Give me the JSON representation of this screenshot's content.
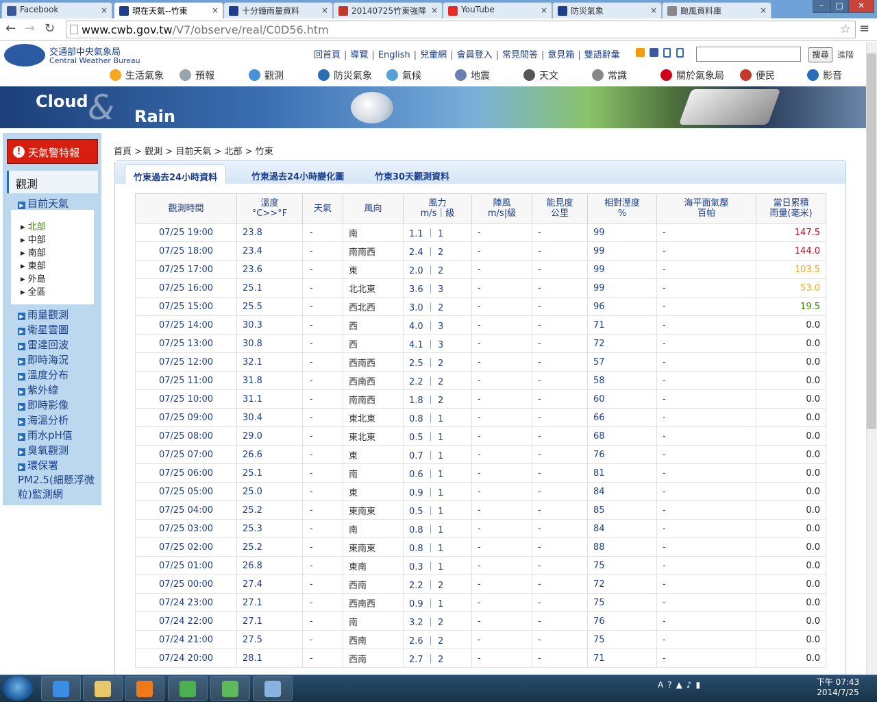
{
  "browser": {
    "tabs": [
      {
        "label": "Facebook",
        "icon": "facebook-icon",
        "color": "#3b5998",
        "active": false
      },
      {
        "label": "現在天氣--竹東",
        "icon": "cwb-eye-icon",
        "color": "#1d3f8a",
        "active": true
      },
      {
        "label": "十分鐘雨量資料",
        "icon": "cwb-eye-icon",
        "color": "#1d3f8a",
        "active": false
      },
      {
        "label": "20140725竹東強降",
        "icon": "swirl-icon",
        "color": "#c0392b",
        "active": false
      },
      {
        "label": "YouTube",
        "icon": "youtube-icon",
        "color": "#e52d27",
        "active": false
      },
      {
        "label": "防災氣象",
        "icon": "cwb-eye-icon",
        "color": "#1d3f8a",
        "active": false
      },
      {
        "label": "颱風資料庫",
        "icon": "document-icon",
        "color": "#888888",
        "active": false
      }
    ],
    "url_domain": "www.cwb.gov.tw",
    "url_path": "/V7/observe/real/C0D56.htm"
  },
  "site": {
    "logo_zh": "交通部中央氣象局",
    "logo_en": "Central Weather Bureau",
    "top_links": [
      "回首頁",
      "導覽",
      "English",
      "兒童網",
      "會員登入",
      "常見問答",
      "意見箱",
      "雙語辭彙"
    ],
    "search_value": "",
    "search_button": "搜尋",
    "advanced": "進階",
    "nav": [
      {
        "label": "生活氣象",
        "icon": "sun-icon",
        "color": "#f5a623"
      },
      {
        "label": "預報",
        "icon": "cloud-icon",
        "color": "#9aa4ad"
      },
      {
        "label": "觀測",
        "icon": "observe-icon",
        "color": "#4a90d9"
      },
      {
        "label": "防災氣象",
        "icon": "typhoon-icon",
        "color": "#2b6cb5"
      },
      {
        "label": "氣候",
        "icon": "climate-icon",
        "color": "#5aa0d8"
      },
      {
        "label": "地震",
        "icon": "earthquake-icon",
        "color": "#6a7fb0"
      },
      {
        "label": "天文",
        "icon": "telescope-icon",
        "color": "#555555"
      },
      {
        "label": "常識",
        "icon": "magnifier-icon",
        "color": "#888888"
      },
      {
        "label": "關於氣象局",
        "icon": "person-icon",
        "color": "#d0021b"
      },
      {
        "label": "便民",
        "icon": "users-icon",
        "color": "#c0392b"
      },
      {
        "label": "影音",
        "icon": "play-icon",
        "color": "#2b6cb5"
      }
    ],
    "banner_word1": "Cloud",
    "banner_word2": "&",
    "banner_word3": "Rain"
  },
  "sidebar": {
    "alert": "天氣警特報",
    "section": "觀測",
    "current": "目前天氣",
    "regions": [
      "北部",
      "中部",
      "南部",
      "東部",
      "外島",
      "全區"
    ],
    "selected_region": "北部",
    "links": [
      "雨量觀測",
      "衛星雲圖",
      "雷達回波",
      "即時海況",
      "溫度分布",
      "紫外線",
      "即時影像",
      "海溫分析",
      "雨水pH值",
      "臭氧觀測",
      "環保署"
    ],
    "pm_link": "PM2.5(細懸浮微粒)監測網"
  },
  "content": {
    "breadcrumb": "首頁 > 觀測 > 目前天氣 > 北部 > 竹東",
    "tabs": [
      "竹東過去24小時資料",
      "竹東過去24小時變化圖",
      "竹東30天觀測資料"
    ],
    "headers": [
      [
        "觀測時間",
        ""
      ],
      [
        "溫度",
        "°C>>°F"
      ],
      [
        "天氣",
        ""
      ],
      [
        "風向",
        ""
      ],
      [
        "風力",
        "m/s｜級"
      ],
      [
        "陣風",
        "m/s|級"
      ],
      [
        "能見度",
        "公里"
      ],
      [
        "相對溼度",
        "%"
      ],
      [
        "海平面氣壓",
        "百帕"
      ],
      [
        "當日累積",
        "雨量(毫米)"
      ]
    ],
    "rows": [
      [
        "07/25 19:00",
        "23.8",
        "-",
        "南",
        "1.1 ｜ 1",
        "-",
        "-",
        "99",
        "-",
        "147.5"
      ],
      [
        "07/25 18:00",
        "23.4",
        "-",
        "南南西",
        "2.4 ｜ 2",
        "-",
        "-",
        "99",
        "-",
        "144.0"
      ],
      [
        "07/25 17:00",
        "23.6",
        "-",
        "東",
        "2.0 ｜ 2",
        "-",
        "-",
        "99",
        "-",
        "103.5"
      ],
      [
        "07/25 16:00",
        "25.1",
        "-",
        "北北東",
        "3.6 ｜ 3",
        "-",
        "-",
        "99",
        "-",
        "53.0"
      ],
      [
        "07/25 15:00",
        "25.5",
        "-",
        "西北西",
        "3.0 ｜ 2",
        "-",
        "-",
        "96",
        "-",
        "19.5"
      ],
      [
        "07/25 14:00",
        "30.3",
        "-",
        "西",
        "4.0 ｜ 3",
        "-",
        "-",
        "71",
        "-",
        "0.0"
      ],
      [
        "07/25 13:00",
        "30.8",
        "-",
        "西",
        "4.1 ｜ 3",
        "-",
        "-",
        "72",
        "-",
        "0.0"
      ],
      [
        "07/25 12:00",
        "32.1",
        "-",
        "西南西",
        "2.5 ｜ 2",
        "-",
        "-",
        "57",
        "-",
        "0.0"
      ],
      [
        "07/25 11:00",
        "31.8",
        "-",
        "西南西",
        "2.2 ｜ 2",
        "-",
        "-",
        "58",
        "-",
        "0.0"
      ],
      [
        "07/25 10:00",
        "31.1",
        "-",
        "南南西",
        "1.8 ｜ 2",
        "-",
        "-",
        "60",
        "-",
        "0.0"
      ],
      [
        "07/25 09:00",
        "30.4",
        "-",
        "東北東",
        "0.8 ｜ 1",
        "-",
        "-",
        "66",
        "-",
        "0.0"
      ],
      [
        "07/25 08:00",
        "29.0",
        "-",
        "東北東",
        "0.5 ｜ 1",
        "-",
        "-",
        "68",
        "-",
        "0.0"
      ],
      [
        "07/25 07:00",
        "26.6",
        "-",
        "東",
        "0.7 ｜ 1",
        "-",
        "-",
        "76",
        "-",
        "0.0"
      ],
      [
        "07/25 06:00",
        "25.1",
        "-",
        "南",
        "0.6 ｜ 1",
        "-",
        "-",
        "81",
        "-",
        "0.0"
      ],
      [
        "07/25 05:00",
        "25.0",
        "-",
        "東",
        "0.9 ｜ 1",
        "-",
        "-",
        "84",
        "-",
        "0.0"
      ],
      [
        "07/25 04:00",
        "25.2",
        "-",
        "東南東",
        "0.5 ｜ 1",
        "-",
        "-",
        "85",
        "-",
        "0.0"
      ],
      [
        "07/25 03:00",
        "25.3",
        "-",
        "南",
        "0.8 ｜ 1",
        "-",
        "-",
        "84",
        "-",
        "0.0"
      ],
      [
        "07/25 02:00",
        "25.2",
        "-",
        "東南東",
        "0.8 ｜ 1",
        "-",
        "-",
        "88",
        "-",
        "0.0"
      ],
      [
        "07/25 01:00",
        "26.8",
        "-",
        "東南",
        "0.3 ｜ 1",
        "-",
        "-",
        "75",
        "-",
        "0.0"
      ],
      [
        "07/25 00:00",
        "27.4",
        "-",
        "西南",
        "2.2 ｜ 2",
        "-",
        "-",
        "72",
        "-",
        "0.0"
      ],
      [
        "07/24 23:00",
        "27.1",
        "-",
        "西南西",
        "0.9 ｜ 1",
        "-",
        "-",
        "75",
        "-",
        "0.0"
      ],
      [
        "07/24 22:00",
        "27.1",
        "-",
        "南",
        "3.2 ｜ 2",
        "-",
        "-",
        "76",
        "-",
        "0.0"
      ],
      [
        "07/24 21:00",
        "27.5",
        "-",
        "西南",
        "2.6 ｜ 2",
        "-",
        "-",
        "75",
        "-",
        "0.0"
      ],
      [
        "07/24 20:00",
        "28.1",
        "-",
        "西南",
        "2.7 ｜ 2",
        "-",
        "-",
        "71",
        "-",
        "0.0"
      ]
    ],
    "rain_colors": {
      "147.5": "#d0021b",
      "144.0": "#d0021b",
      "103.5": "#f5a623",
      "53.0": "#f5a623",
      "19.5": "#3b8a00"
    }
  },
  "taskbar": {
    "apps": [
      {
        "name": "ie-icon",
        "color": "#3a8ee6"
      },
      {
        "name": "explorer-icon",
        "color": "#e8c86a"
      },
      {
        "name": "media-player-icon",
        "color": "#f07a1a"
      },
      {
        "name": "chrome-icon",
        "color": "#4caf50"
      },
      {
        "name": "globe-icon",
        "color": "#5fb95a"
      },
      {
        "name": "paint-icon",
        "color": "#8ab4e0"
      }
    ],
    "time": "下午 07:43",
    "date": "2014/7/25",
    "tray": [
      "A",
      "?",
      "▲"
    ]
  }
}
